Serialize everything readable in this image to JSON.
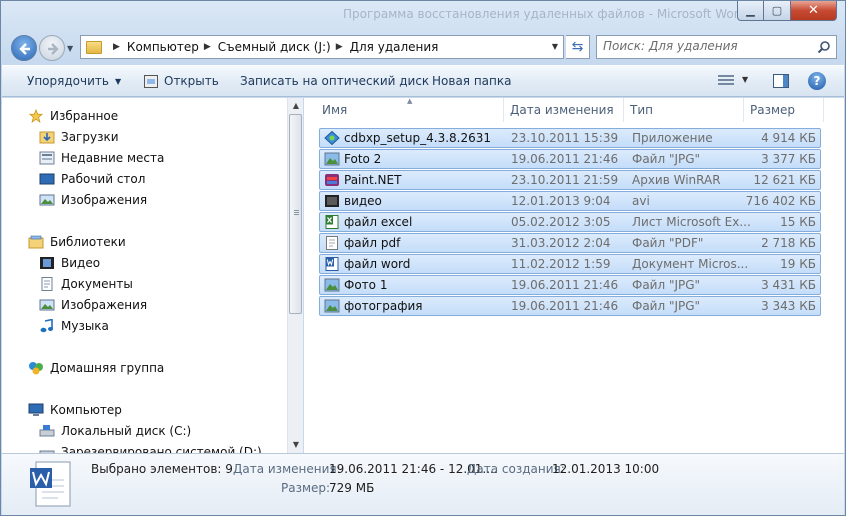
{
  "window": {
    "title": "Программа восстановления удаленных файлов - Microsoft Word"
  },
  "address": {
    "crumbs": [
      "Компьютер",
      "Съемный диск (J:)",
      "Для удаления"
    ],
    "search_placeholder": "Поиск: Для удаления"
  },
  "toolbar": {
    "organize": "Упорядочить",
    "open": "Открыть",
    "burn": "Записать на оптический диск",
    "new_folder": "Новая папка"
  },
  "nav": {
    "favorites": "Избранное",
    "downloads": "Загрузки",
    "recent": "Недавние места",
    "desktop": "Рабочий стол",
    "images": "Изображения",
    "libraries": "Библиотеки",
    "video": "Видео",
    "documents": "Документы",
    "lib_images": "Изображения",
    "music": "Музыка",
    "homegroup": "Домашняя группа",
    "computer": "Компьютер",
    "local_c": "Локальный диск (C:)",
    "reserved": "Зарезервировано системой (D:)"
  },
  "columns": {
    "name": "Имя",
    "date": "Дата изменения",
    "type": "Тип",
    "size": "Размер"
  },
  "files": [
    {
      "name": "cdbxp_setup_4.3.8.2631",
      "date": "23.10.2011 15:39",
      "type": "Приложение",
      "size": "4 914 КБ",
      "icon": "installer-icon"
    },
    {
      "name": "Foto 2",
      "date": "19.06.2011 21:46",
      "type": "Файл \"JPG\"",
      "size": "3 377 КБ",
      "icon": "image-file-icon"
    },
    {
      "name": "Paint.NET",
      "date": "23.10.2011 21:59",
      "type": "Архив WinRAR",
      "size": "12 621 КБ",
      "icon": "rar-archive-icon"
    },
    {
      "name": "видео",
      "date": "12.01.2013 9:04",
      "type": "avi",
      "size": "716 402 КБ",
      "icon": "video-file-icon"
    },
    {
      "name": "файл  excel",
      "date": "05.02.2012 3:05",
      "type": "Лист Microsoft Ex...",
      "size": "15 КБ",
      "icon": "excel-file-icon"
    },
    {
      "name": "файл pdf",
      "date": "31.03.2012 2:04",
      "type": "Файл \"PDF\"",
      "size": "2 718 КБ",
      "icon": "pdf-file-icon"
    },
    {
      "name": "файл word",
      "date": "11.02.2012 1:59",
      "type": "Документ Micros...",
      "size": "19 КБ",
      "icon": "word-file-icon"
    },
    {
      "name": "Фото 1",
      "date": "19.06.2011 21:46",
      "type": "Файл \"JPG\"",
      "size": "3 431 КБ",
      "icon": "image-file-icon"
    },
    {
      "name": "фотография",
      "date": "19.06.2011 21:46",
      "type": "Файл \"JPG\"",
      "size": "3 343 КБ",
      "icon": "image-file-icon"
    }
  ],
  "details": {
    "selected_label": "Выбрано элементов: 9",
    "modified_label": "Дата изменения:",
    "modified_value": "19.06.2011 21:46 - 12.01....",
    "created_label": "Дата создания:",
    "created_value": "12.01.2013 10:00",
    "size_label": "Размер:",
    "size_value": "729 МБ"
  },
  "colors": {
    "selection": "#cce2fa",
    "selection_border": "#84acdd",
    "accent": "#2a67b5"
  }
}
